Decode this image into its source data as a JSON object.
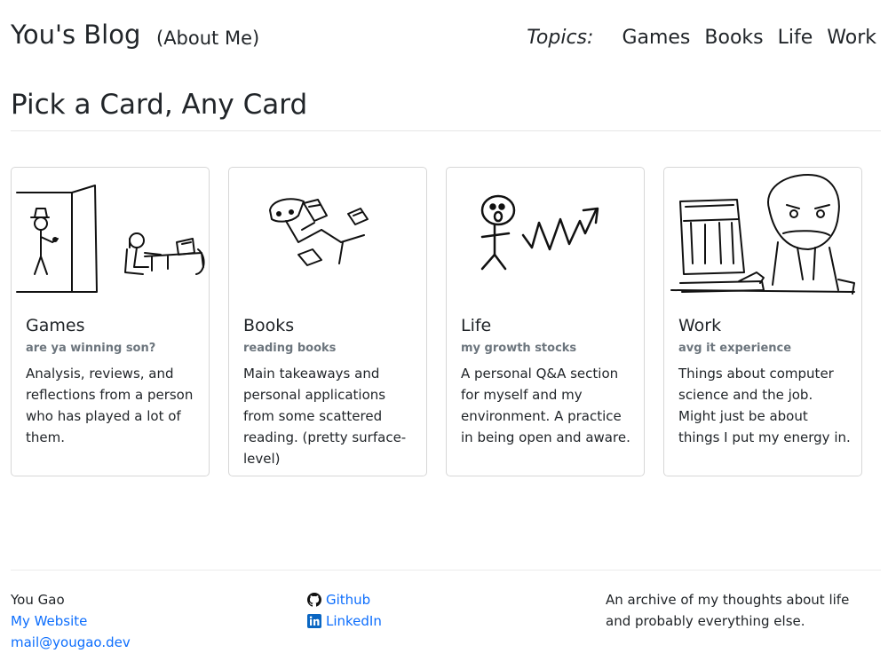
{
  "header": {
    "brand": "You's Blog",
    "about": "(About Me)",
    "topics_label": "Topics:",
    "topics": [
      "Games",
      "Books",
      "Life",
      "Work"
    ]
  },
  "main": {
    "title": "Pick a Card, Any Card",
    "cards": [
      {
        "title": "Games",
        "subtitle": "are ya winning son?",
        "text": "Analysis, reviews, and reflections from a person who has played a lot of them.",
        "image": "games-doodle"
      },
      {
        "title": "Books",
        "subtitle": "reading books",
        "text": "Main takeaways and personal applications from some scattered reading. (pretty surface-level)",
        "image": "books-doodle"
      },
      {
        "title": "Life",
        "subtitle": "my growth stocks",
        "text": "A personal Q&A section for myself and my environment. A practice in being open and aware.",
        "image": "life-doodle"
      },
      {
        "title": "Work",
        "subtitle": "avg it experience",
        "text": "Things about computer science and the job. Might just be about things I put my energy in.",
        "image": "work-doodle"
      }
    ]
  },
  "footer": {
    "name": "You Gao",
    "website": "My Website",
    "email": "mail@yougao.dev",
    "github": "Github",
    "linkedin": "LinkedIn",
    "description": "An archive of my thoughts about life and probably everything else.",
    "link_color": "#0d6efd"
  }
}
